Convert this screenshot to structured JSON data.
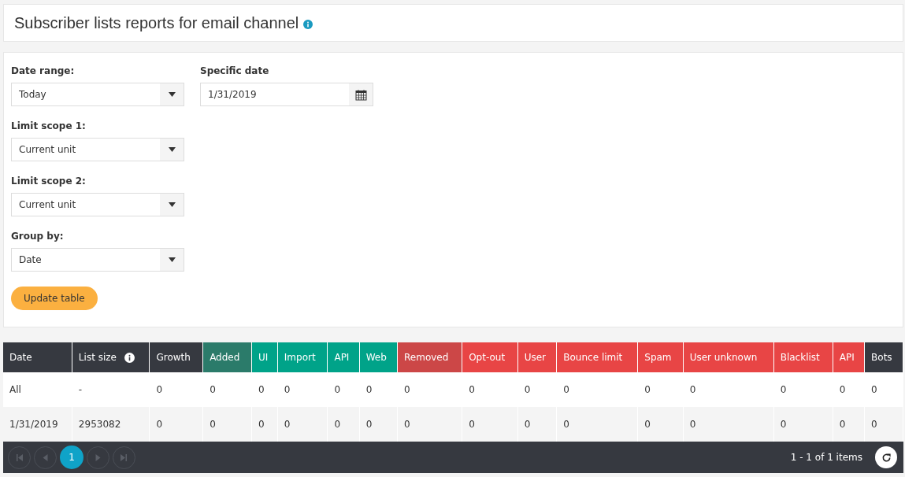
{
  "header": {
    "title": "Subscriber lists reports for email channel"
  },
  "filters": [
    {
      "label": "Date range:",
      "kind": "select",
      "value": "Today"
    },
    {
      "label": "Specific date",
      "kind": "date",
      "value": "1/31/2019"
    },
    {
      "label": "Limit scope 1:",
      "kind": "select",
      "value": "Current unit"
    },
    {
      "label": "Limit scope 2:",
      "kind": "select",
      "value": "Current unit"
    },
    {
      "label": "Group by:",
      "kind": "select",
      "value": "Date"
    }
  ],
  "update_button": "Update table",
  "table": {
    "columns": [
      {
        "label": "Date",
        "color": "#363940",
        "info": false
      },
      {
        "label": "List size",
        "color": "#363940",
        "info": true
      },
      {
        "label": "Growth",
        "color": "#363940",
        "info": false
      },
      {
        "label": "Added",
        "color": "#2b7b6a",
        "info": false
      },
      {
        "label": "UI",
        "color": "#00a389",
        "info": false
      },
      {
        "label": "Import",
        "color": "#00a389",
        "info": false
      },
      {
        "label": "API",
        "color": "#00a389",
        "info": false
      },
      {
        "label": "Web",
        "color": "#00a389",
        "info": false
      },
      {
        "label": "Removed",
        "color": "#cc4747",
        "info": false
      },
      {
        "label": "Opt-out",
        "color": "#e84545",
        "info": false
      },
      {
        "label": "User",
        "color": "#e84545",
        "info": false
      },
      {
        "label": "Bounce limit",
        "color": "#e84545",
        "info": false
      },
      {
        "label": "Spam",
        "color": "#e84545",
        "info": false
      },
      {
        "label": "User unknown",
        "color": "#e84545",
        "info": false
      },
      {
        "label": "Blacklist",
        "color": "#e84545",
        "info": false
      },
      {
        "label": "API",
        "color": "#e84545",
        "info": false
      },
      {
        "label": "Bots",
        "color": "#363940",
        "info": false
      }
    ],
    "rows": [
      [
        "All",
        "-",
        "0",
        "0",
        "0",
        "0",
        "0",
        "0",
        "0",
        "0",
        "0",
        "0",
        "0",
        "0",
        "0",
        "0",
        "0"
      ],
      [
        "1/31/2019",
        "2953082",
        "0",
        "0",
        "0",
        "0",
        "0",
        "0",
        "0",
        "0",
        "0",
        "0",
        "0",
        "0",
        "0",
        "0",
        "0"
      ]
    ]
  },
  "pager": {
    "pages": [
      {
        "label": "1",
        "selected": true
      }
    ],
    "summary": "1 - 1 of 1 items"
  }
}
